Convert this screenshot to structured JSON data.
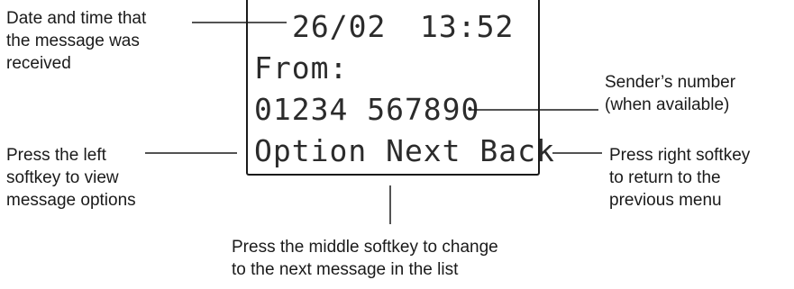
{
  "callouts": {
    "datetime": [
      "Date and time that",
      "the message was",
      "received"
    ],
    "sender": [
      "Sender’s number",
      "(when available)"
    ],
    "left_softkey": [
      "Press the left",
      "softkey to view",
      "message options"
    ],
    "right_softkey": [
      "Press right softkey",
      "to return to the",
      "previous menu"
    ],
    "middle_softkey": [
      "Press the middle softkey to change",
      "to the next message in the list"
    ]
  },
  "display": {
    "date": "26/02",
    "time": "13:52",
    "from_label": "From:",
    "sender_number": "01234 567890",
    "softkeys": "Option Next Back"
  }
}
